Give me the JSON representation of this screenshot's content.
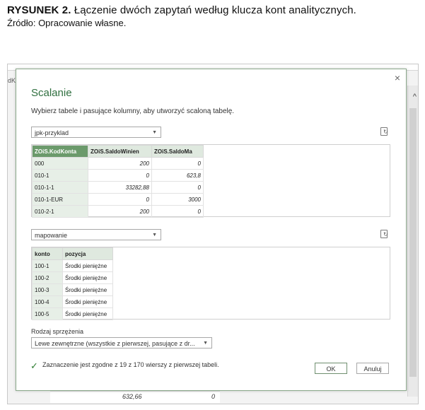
{
  "caption": {
    "figure_label": "RYSUNEK 2.",
    "title": "Łączenie dwóch zapytań według klucza kont analitycznych.",
    "source": "Źródło: Opracowanie własne."
  },
  "background": {
    "left_label": "dK",
    "bottom_value_1": "632,66",
    "bottom_value_2": "0"
  },
  "dialog": {
    "title": "Scalanie",
    "description": "Wybierz tabele i pasujące kolumny, aby utworzyć scaloną tabelę.",
    "close_label": "×",
    "table1": {
      "selected": "jpk-przyklad",
      "columns": [
        "ZOiS.KodKonta",
        "ZOiS.SaldoWinien",
        "ZOiS.SaldoMa"
      ],
      "rows": [
        [
          "000",
          "200",
          "0"
        ],
        [
          "010-1",
          "0",
          "623,8"
        ],
        [
          "010-1-1",
          "33282,88",
          "0"
        ],
        [
          "010-1-EUR",
          "0",
          "3000"
        ],
        [
          "010-2-1",
          "200",
          "0"
        ]
      ]
    },
    "table2": {
      "selected": "mapowanie",
      "columns": [
        "konto",
        "pozycja"
      ],
      "rows": [
        [
          "100-1",
          "Środki pieniężne"
        ],
        [
          "100-2",
          "Środki pieniężne"
        ],
        [
          "100-3",
          "Środki pieniężne"
        ],
        [
          "100-4",
          "Środki pieniężne"
        ],
        [
          "100-5",
          "Środki pieniężne"
        ]
      ]
    },
    "join_label": "Rodzaj sprzężenia",
    "join_value": "Lewe zewnętrzne (wszystkie z pierwszej, pasujące z dr...",
    "status": "Zaznaczenie jest zgodne z 19 z 170 wierszy z pierwszej tabeli.",
    "ok_label": "OK",
    "cancel_label": "Anuluj"
  }
}
